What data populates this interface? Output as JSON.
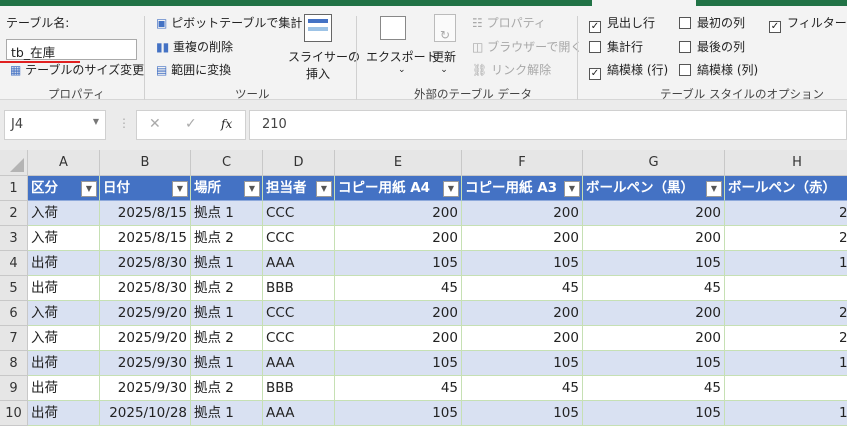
{
  "ribbon": {
    "table_name_label": "テーブル名:",
    "table_name_value": "tb_在庫",
    "resize_table": "テーブルのサイズ変更",
    "group_properties": "プロパティ",
    "pivot_summary": "ピボットテーブルで集計",
    "remove_duplicates": "重複の削除",
    "convert_to_range": "範囲に変換",
    "insert_slicer_line1": "スライサーの",
    "insert_slicer_line2": "挿入",
    "group_tools": "ツール",
    "export": "エクスポート",
    "refresh": "更新",
    "properties": "プロパティ",
    "open_in_browser": "ブラウザーで開く",
    "unlink": "リンク解除",
    "group_external": "外部のテーブル データ",
    "options": [
      {
        "label": "見出し行",
        "checked": true
      },
      {
        "label": "集計行",
        "checked": false
      },
      {
        "label": "縞模様 (行)",
        "checked": true
      },
      {
        "label": "最初の列",
        "checked": false
      },
      {
        "label": "最後の列",
        "checked": false
      },
      {
        "label": "縞模様 (列)",
        "checked": false
      },
      {
        "label": "フィルター ボタ",
        "checked": true
      }
    ],
    "group_style_options": "テーブル スタイルのオプション"
  },
  "formula_bar": {
    "name_box": "J4",
    "cancel": "✕",
    "enter": "✓",
    "fx": "fx",
    "value": "210"
  },
  "sheet": {
    "columns": [
      "A",
      "B",
      "C",
      "D",
      "E",
      "F",
      "G",
      "H"
    ],
    "headers": [
      "区分",
      "日付",
      "場所",
      "担当者",
      "コピー用紙 A4",
      "コピー用紙 A3",
      "ボールペン（黒）",
      "ボールペン（赤）"
    ],
    "rows": [
      {
        "n": "2",
        "cells": [
          "入荷",
          "2025/8/15",
          "拠点 1",
          "CCC",
          "200",
          "200",
          "200",
          "2"
        ]
      },
      {
        "n": "3",
        "cells": [
          "入荷",
          "2025/8/15",
          "拠点 2",
          "CCC",
          "200",
          "200",
          "200",
          "2"
        ]
      },
      {
        "n": "4",
        "cells": [
          "出荷",
          "2025/8/30",
          "拠点 1",
          "AAA",
          "105",
          "105",
          "105",
          "1"
        ]
      },
      {
        "n": "5",
        "cells": [
          "出荷",
          "2025/8/30",
          "拠点 2",
          "BBB",
          "45",
          "45",
          "45",
          ""
        ]
      },
      {
        "n": "6",
        "cells": [
          "入荷",
          "2025/9/20",
          "拠点 1",
          "CCC",
          "200",
          "200",
          "200",
          "2"
        ]
      },
      {
        "n": "7",
        "cells": [
          "入荷",
          "2025/9/20",
          "拠点 2",
          "CCC",
          "200",
          "200",
          "200",
          "2"
        ]
      },
      {
        "n": "8",
        "cells": [
          "出荷",
          "2025/9/30",
          "拠点 1",
          "AAA",
          "105",
          "105",
          "105",
          "1"
        ]
      },
      {
        "n": "9",
        "cells": [
          "出荷",
          "2025/9/30",
          "拠点 2",
          "BBB",
          "45",
          "45",
          "45",
          ""
        ]
      },
      {
        "n": "10",
        "cells": [
          "出荷",
          "2025/10/28",
          "拠点 1",
          "AAA",
          "105",
          "105",
          "105",
          "1"
        ]
      }
    ]
  },
  "colors": {
    "header": "#4472c4",
    "band": "#d9e1f2",
    "accent": "#217346"
  }
}
